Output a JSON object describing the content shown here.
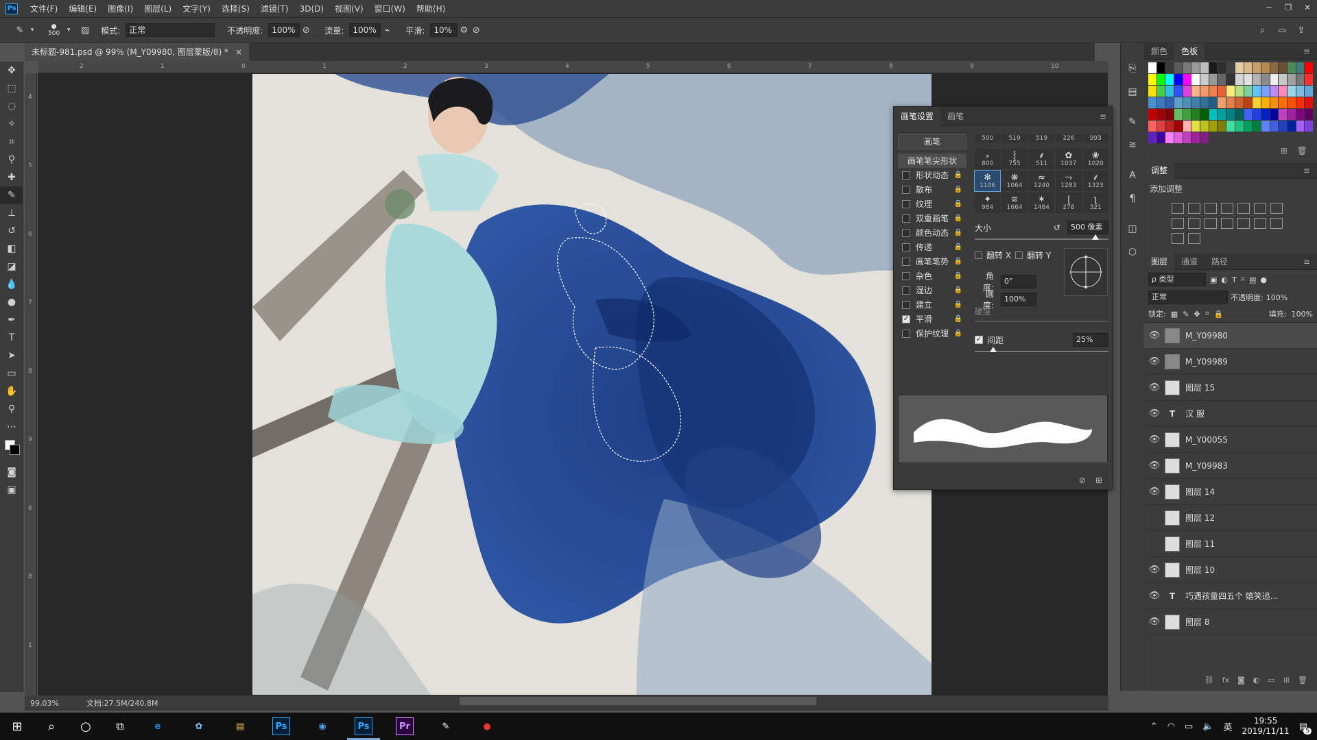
{
  "app": {
    "logo": "Ps",
    "menus": [
      "文件(F)",
      "编辑(E)",
      "图像(I)",
      "图层(L)",
      "文字(Y)",
      "选择(S)",
      "滤镜(T)",
      "3D(D)",
      "视图(V)",
      "窗口(W)",
      "帮助(H)"
    ]
  },
  "options": {
    "brush_size": "500",
    "mode_label": "模式:",
    "mode_value": "正常",
    "opacity_label": "不透明度:",
    "opacity_value": "100%",
    "flow_label": "流量:",
    "flow_value": "100%",
    "smooth_label": "平滑:",
    "smooth_value": "10%"
  },
  "document": {
    "tab_title": "未标题-981.psd @ 99% (M_Y09980, 图层蒙版/8) *",
    "close": "×"
  },
  "rulers": {
    "h": [
      "2",
      "1",
      "0",
      "1",
      "2",
      "3",
      "4",
      "5",
      "6",
      "7",
      "8",
      "9",
      "10"
    ],
    "v": [
      "4",
      "5",
      "6",
      "7",
      "8",
      "9",
      "6",
      "8",
      "1"
    ]
  },
  "status": {
    "zoom": "99.03%",
    "doc": "文档:27.5M/240.8M"
  },
  "brush_panel": {
    "tabs": [
      "画笔设置",
      "画笔"
    ],
    "brush_button": "画笔",
    "tip_shape": "画笔笔尖形状",
    "options": [
      {
        "label": "形状动态",
        "checked": false
      },
      {
        "label": "散布",
        "checked": false
      },
      {
        "label": "纹理",
        "checked": false
      },
      {
        "label": "双重画笔",
        "checked": false
      },
      {
        "label": "颜色动态",
        "checked": false
      },
      {
        "label": "传递",
        "checked": false
      },
      {
        "label": "画笔笔势",
        "checked": false
      },
      {
        "label": "杂色",
        "checked": false
      },
      {
        "label": "湿边",
        "checked": false
      },
      {
        "label": "建立",
        "checked": false
      },
      {
        "label": "平滑",
        "checked": true
      },
      {
        "label": "保护纹理",
        "checked": false
      }
    ],
    "tips_top": [
      "500",
      "519",
      "519",
      "226",
      "993"
    ],
    "tips": [
      "800",
      "755",
      "511",
      "1037",
      "1020",
      "1106",
      "1064",
      "1240",
      "1283",
      "1323",
      "984",
      "1664",
      "1484",
      "278",
      "321"
    ],
    "size_label": "大小",
    "size_value": "500 像素",
    "flip_x": "翻转 X",
    "flip_y": "翻转 Y",
    "angle_label": "角度:",
    "angle_value": "0°",
    "round_label": "圆度:",
    "round_value": "100%",
    "hardness_label": "硬度",
    "spacing_label": "间距",
    "spacing_value": "25%"
  },
  "color_panel": {
    "tabs": [
      "颜色",
      "色板"
    ]
  },
  "adjust_panel": {
    "tab": "调整",
    "add_label": "添加调整"
  },
  "layers_panel": {
    "tabs": [
      "图层",
      "通道",
      "路径"
    ],
    "filter": "ρ 类型",
    "blend": "正常",
    "opacity_label": "不透明度:",
    "opacity_value": "100%",
    "lock_label": "锁定:",
    "fill_label": "填充:",
    "fill_value": "100%",
    "layers": [
      {
        "name": "M_Y09980",
        "kind": "mask",
        "visible": true,
        "selected": true
      },
      {
        "name": "M_Y09989",
        "kind": "mask",
        "visible": true
      },
      {
        "name": "图层 15",
        "kind": "pixel",
        "visible": true
      },
      {
        "name": "汉 服",
        "kind": "text",
        "visible": true
      },
      {
        "name": "M_Y00055",
        "kind": "smart",
        "visible": true
      },
      {
        "name": "M_Y09983",
        "kind": "smart",
        "visible": true
      },
      {
        "name": "图层 14",
        "kind": "pixel",
        "visible": true
      },
      {
        "name": "图层 12",
        "kind": "pixel",
        "visible": false
      },
      {
        "name": "图层 11",
        "kind": "pixel",
        "visible": false
      },
      {
        "name": "图层 10",
        "kind": "pixel",
        "visible": true
      },
      {
        "name": "巧遇孩童四五个 嬉笑追...",
        "kind": "text",
        "visible": true
      },
      {
        "name": "图层 8",
        "kind": "pixel",
        "visible": true
      }
    ]
  },
  "taskbar": {
    "apps": [
      {
        "name": "edge-icon",
        "label": "e",
        "color": "#1e88e5"
      },
      {
        "name": "photos-icon",
        "label": "✿",
        "color": "#7ec8ff"
      },
      {
        "name": "explorer-icon",
        "label": "▤",
        "color": "#f2c94c"
      },
      {
        "name": "photoshop-icon",
        "label": "Ps",
        "color": "#31a8ff"
      },
      {
        "name": "browser-icon",
        "label": "◉",
        "color": "#4aa3ff"
      },
      {
        "name": "photoshop-active-icon",
        "label": "Ps",
        "color": "#31a8ff"
      },
      {
        "name": "premiere-icon",
        "label": "Pr",
        "color": "#d291ff"
      },
      {
        "name": "app-pen-icon",
        "label": "✎",
        "color": "#ffffff"
      },
      {
        "name": "recorder-icon",
        "label": "●",
        "color": "#e53935"
      }
    ],
    "ime": "英",
    "time": "19:55",
    "date": "2019/11/11",
    "notif_count": "5"
  }
}
